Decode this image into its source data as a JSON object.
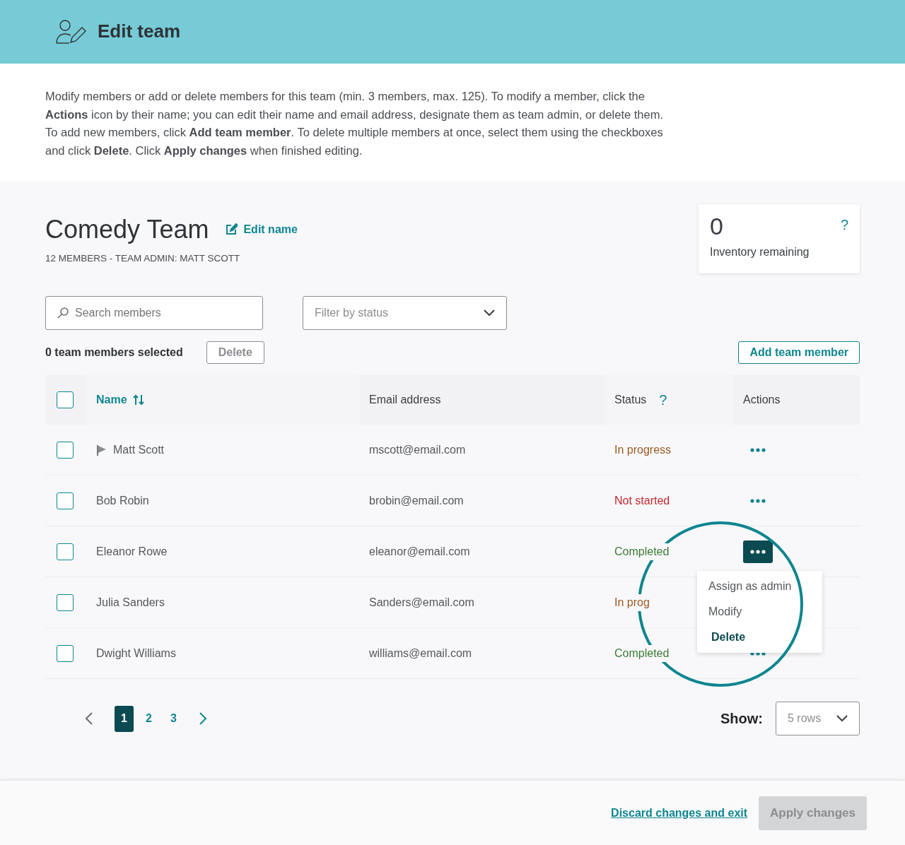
{
  "header": {
    "title": "Edit team"
  },
  "intro": "Modify members or add or delete members for this team (min. 3 members, max. 125). To modify a member, click the **Actions** icon by their name; you can edit their name and email address, designate them as team admin, or delete them. To add new members, click **Add team member**. To delete multiple members at once, select them using the checkboxes and click **Delete**. Click **Apply changes** when finished editing.",
  "team": {
    "name": "Comedy Team",
    "edit_link": "Edit name",
    "subtitle": "12 MEMBERS - TEAM ADMIN: MATT SCOTT"
  },
  "inventory": {
    "count": "0",
    "label": "Inventory remaining",
    "help": "?"
  },
  "search": {
    "placeholder": "Search members"
  },
  "filter": {
    "placeholder": "Filter by status"
  },
  "selection": {
    "text": "0 team members selected",
    "delete_button": "Delete",
    "delete_disabled": true
  },
  "add_button": "Add team member",
  "table": {
    "select_all_checked": false,
    "columns": [
      {
        "label": "Name",
        "sortable": true
      },
      {
        "label": "Email address",
        "sortable": false
      },
      {
        "label": "Status",
        "sortable": false,
        "help": "?"
      },
      {
        "label": "Actions",
        "sortable": false
      }
    ],
    "rows": [
      {
        "checked": false,
        "admin": true,
        "name": "Matt Scott",
        "email": "mscott@email.com",
        "status": "In progress",
        "color": "#9a5b23",
        "menu_open": false
      },
      {
        "checked": false,
        "admin": false,
        "name": "Bob Robin",
        "email": "brobin@email.com",
        "status": "Not started",
        "color": "#c0282d",
        "menu_open": false
      },
      {
        "checked": false,
        "admin": false,
        "name": "Eleanor Rowe",
        "email": "eleanor@email.com",
        "status": "Completed",
        "color": "#3a7a35",
        "menu_open": true
      },
      {
        "checked": false,
        "admin": false,
        "name": "Julia Sanders",
        "email": "Sanders@email.com",
        "status": "In prog",
        "color": "#9a5b23",
        "menu_open": false
      },
      {
        "checked": false,
        "admin": false,
        "name": "Dwight Williams",
        "email": "williams@email.com",
        "status": "Completed",
        "color": "#3a7a35",
        "menu_open": false
      }
    ]
  },
  "action_menu": {
    "highlight_ring": true,
    "items": [
      {
        "label": "Assign as admin",
        "kind": "normal"
      },
      {
        "label": "Modify",
        "kind": "normal"
      },
      {
        "label": "Delete",
        "kind": "strong"
      }
    ]
  },
  "pagination": {
    "pages": [
      {
        "label": "1",
        "selected": true
      },
      {
        "label": "2",
        "selected": false
      },
      {
        "label": "3",
        "selected": false
      }
    ]
  },
  "rows_select": {
    "label": "Show:",
    "value": "5 rows"
  },
  "footer": {
    "discard": "Discard changes and exit",
    "apply": "Apply changes",
    "apply_disabled": true
  }
}
